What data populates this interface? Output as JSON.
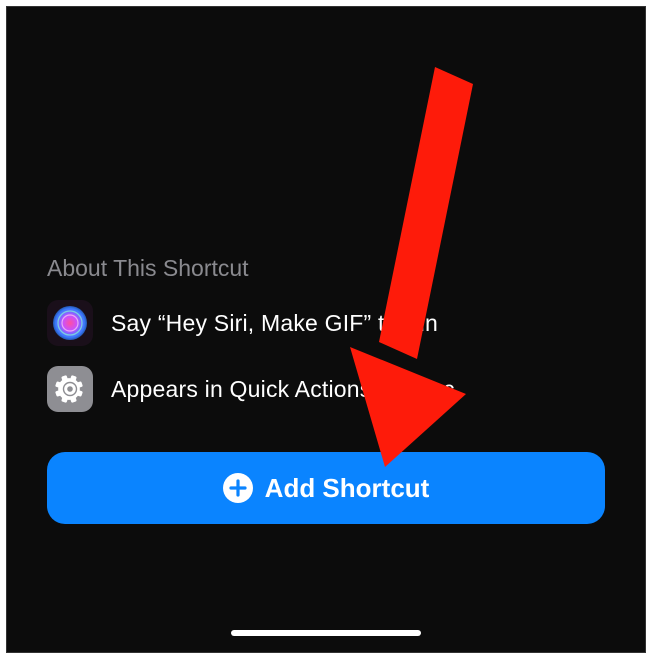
{
  "section": {
    "title": "About This Shortcut"
  },
  "rows": {
    "siri": {
      "text": "Say “Hey Siri, Make GIF” to run"
    },
    "quickactions": {
      "text": "Appears in Quick Actions on Mac"
    }
  },
  "button": {
    "label": "Add Shortcut"
  },
  "colors": {
    "accent": "#0a84ff",
    "background": "#0c0c0c",
    "arrow": "#fe1b0a"
  }
}
